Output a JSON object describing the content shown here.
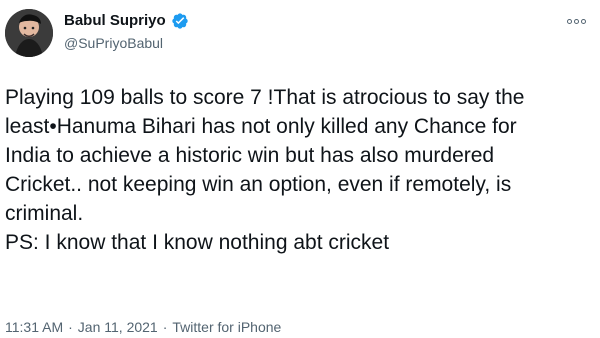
{
  "tweet": {
    "author": {
      "display_name": "Babul Supriyo",
      "handle": "@SuPriyoBabul",
      "verified_icon": "verified-badge-icon",
      "avatar_icon": "profile-photo-icon"
    },
    "more_icon": "more-options-icon",
    "text": {
      "line_1": "Playing 109 balls to score 7 !That is atrocious to say the",
      "line_2": "least•Hanuma Bihari has not only killed any Chance for",
      "line_3": "India to achieve a historic win but has also murdered",
      "line_4": "Cricket.. not keeping win an option, even if remotely, is",
      "line_5": "criminal.",
      "line_6": "PS: I know that I know nothing abt cricket"
    },
    "meta": {
      "time": "11:31 AM",
      "separator_1": "·",
      "date": "Jan 11, 2021",
      "separator_2": "·",
      "source": "Twitter for iPhone"
    }
  },
  "colors": {
    "primary_text": "#0f1419",
    "secondary_text": "#536471",
    "verified_blue": "#1d9bf0",
    "background": "#ffffff"
  }
}
